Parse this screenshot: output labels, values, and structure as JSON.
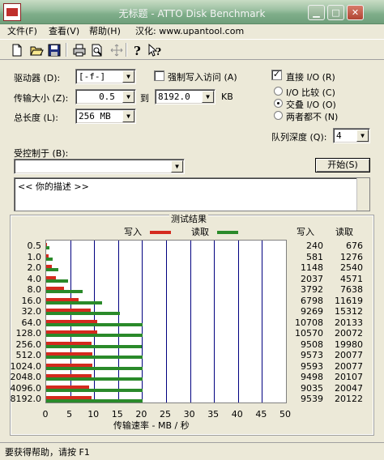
{
  "window": {
    "title": "无标题 - ATTO Disk Benchmark"
  },
  "menu": [
    "文件(F)",
    "查看(V)",
    "帮助(H)",
    "汉化: www.upantool.com"
  ],
  "toolbar": [
    "new-icon",
    "open-icon",
    "save-icon",
    "print-icon",
    "print-preview-icon",
    "move-icon",
    "help-icon",
    "context-help-icon"
  ],
  "form": {
    "drive_label": "驱动器 (D):",
    "drive_value": "[-f-]",
    "force_write_label": "强制写入访问 (A)",
    "force_write_checked": false,
    "direct_io_label": "直接 I/O (R)",
    "direct_io_checked": true,
    "transfer_size_label": "传输大小 (Z):",
    "transfer_from": "0.5",
    "to_label": "到",
    "transfer_to": "8192.0",
    "kb_label": "KB",
    "total_length_label": "总长度 (L):",
    "total_length_value": "256 MB",
    "io_compare_label": "I/O 比较 (C)",
    "overlapped_io_label": "交叠 I/O (O)",
    "neither_label": "两者都不 (N)",
    "selected_io_mode": "交叠 I/O (O)",
    "queue_depth_label": "队列深度 (Q):",
    "queue_depth_value": "4",
    "controlled_by_label": "受控制于 (B):",
    "controlled_by_value": "",
    "start_button": "开始(S)",
    "description": "<<  你的描述  >>"
  },
  "results": {
    "title": "测试结果",
    "write_legend": "写入",
    "read_legend": "读取",
    "write_header": "写入",
    "read_header": "读取",
    "x_axis_label": "传输速率 - MB / 秒"
  },
  "chart_data": {
    "type": "bar",
    "orientation": "horizontal",
    "categories": [
      "0.5",
      "1.0",
      "2.0",
      "4.0",
      "8.0",
      "16.0",
      "32.0",
      "64.0",
      "128.0",
      "256.0",
      "512.0",
      "1024.0",
      "2048.0",
      "4096.0",
      "8192.0"
    ],
    "series": [
      {
        "name": "写入",
        "color": "#d42a1e",
        "values": [
          240,
          581,
          1148,
          2037,
          3792,
          6798,
          9269,
          10708,
          10570,
          9508,
          9573,
          9593,
          9498,
          9035,
          9539
        ]
      },
      {
        "name": "读取",
        "color": "#2a8a2a",
        "values": [
          676,
          1276,
          2540,
          4571,
          7638,
          11619,
          15312,
          20133,
          20072,
          19980,
          20077,
          20077,
          20107,
          20047,
          20122
        ]
      }
    ],
    "xlabel": "传输速率 - MB / 秒",
    "xticks": [
      0,
      5,
      10,
      15,
      20,
      25,
      30,
      35,
      40,
      45,
      50
    ],
    "xlim": [
      0,
      50
    ],
    "grid": true,
    "legend": "top"
  },
  "status": {
    "text": "要获得帮助，请按 F1"
  }
}
